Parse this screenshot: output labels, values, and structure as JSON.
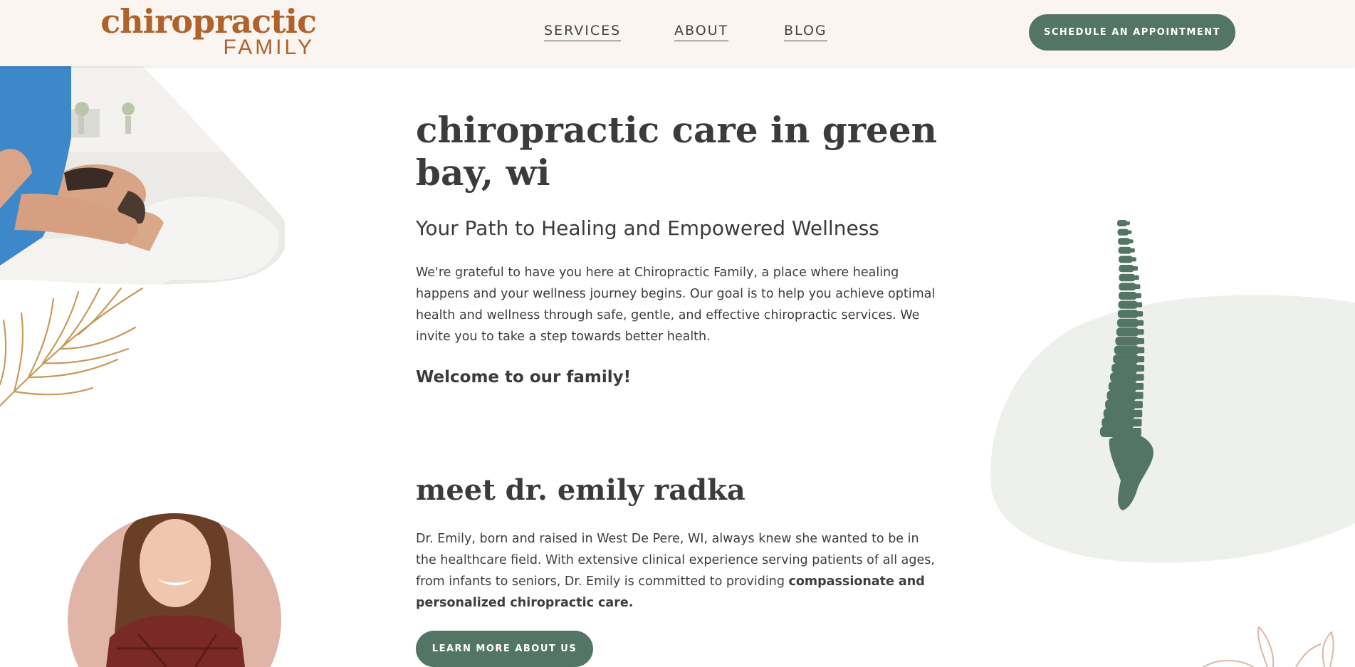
{
  "header": {
    "logo_top": "chiropractic",
    "logo_bottom": "FAMILY",
    "nav": [
      {
        "label": "SERVICES"
      },
      {
        "label": "ABOUT"
      },
      {
        "label": "BLOG"
      }
    ],
    "cta_label": "SCHEDULE AN APPOINTMENT"
  },
  "hero": {
    "title": "chiropractic care in green bay, wi",
    "subtitle": "Your Path to Healing and Empowered Wellness",
    "paragraph": "We're grateful to have you here at Chiropractic Family, a place where healing happens and your wellness journey begins. Our goal is to help you achieve optimal health and wellness through safe, gentle, and effective chiropractic services. We invite you to take a step towards better health.",
    "welcome": "Welcome to our family!"
  },
  "doctor": {
    "title": "meet dr. emily radka",
    "paragraph_start": "Dr. Emily, born and raised in West De Pere, WI, always knew she wanted to be in the healthcare field. With extensive clinical experience serving patients of all ages, from infants to seniors, Dr. Emily is committed to providing ",
    "paragraph_bold": "compassionate and personalized chiropractic care.",
    "button_label": "LEARN MORE ABOUT US"
  },
  "colors": {
    "brand_orange": "#b0622b",
    "brand_green": "#537565",
    "header_bg": "#faf5f0",
    "gold_leaf": "#c89a5a",
    "blob": "#eef0ec"
  },
  "icons": {
    "spine": "spine-illustration",
    "frond": "palm-frond-illustration"
  }
}
